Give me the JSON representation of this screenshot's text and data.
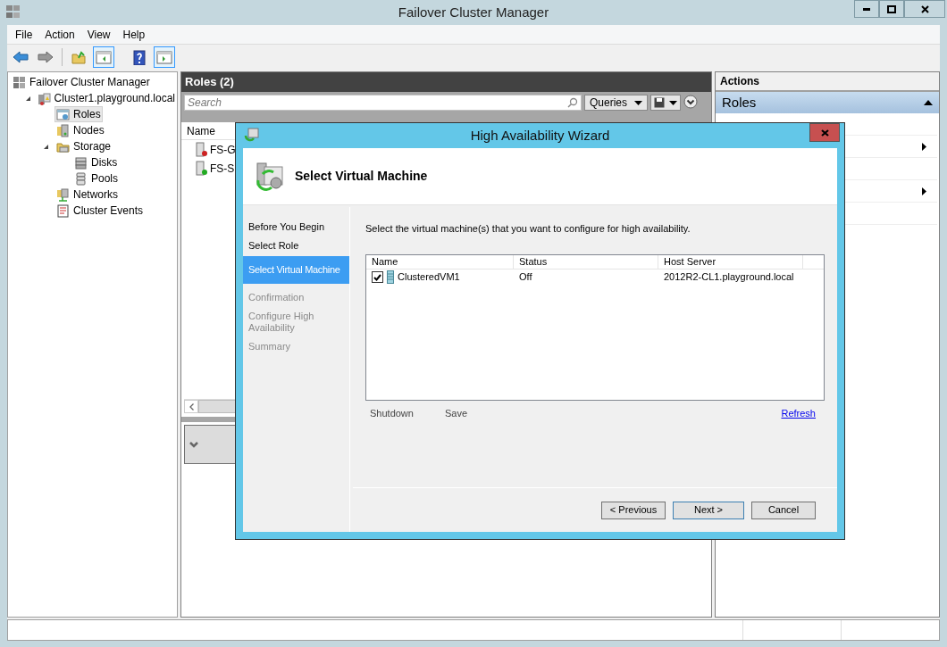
{
  "window": {
    "title": "Failover Cluster Manager"
  },
  "menu": [
    "File",
    "Action",
    "View",
    "Help"
  ],
  "toolbar": [
    {
      "kind": "back",
      "pressed": false
    },
    {
      "kind": "forward",
      "pressed": false
    },
    {
      "kind": "folder",
      "pressed": false
    },
    {
      "kind": "tree-pane",
      "pressed": true
    },
    {
      "kind": "help",
      "pressed": false
    },
    {
      "kind": "action-pane",
      "pressed": true
    }
  ],
  "tree": [
    {
      "label": "Failover Cluster Manager",
      "kind": "manager",
      "selected": false,
      "children": [
        {
          "label": "Cluster1.playground.local",
          "kind": "cluster",
          "selected": false,
          "expanded": true,
          "children": [
            {
              "label": "Roles",
              "kind": "roles",
              "selected": true
            },
            {
              "label": "Nodes",
              "kind": "nodes",
              "selected": false
            },
            {
              "label": "Storage",
              "kind": "storage",
              "selected": false,
              "expanded": true,
              "children": [
                {
                  "label": "Disks",
                  "kind": "disks",
                  "selected": false
                },
                {
                  "label": "Pools",
                  "kind": "pools",
                  "selected": false
                }
              ]
            },
            {
              "label": "Networks",
              "kind": "networks",
              "selected": false
            },
            {
              "label": "Cluster Events",
              "kind": "events",
              "selected": false
            }
          ]
        }
      ]
    }
  ],
  "roles_pane": {
    "title": "Roles (2)",
    "search": {
      "placeholder": "Search"
    },
    "queries_button": "Queries",
    "columns": [
      "Name"
    ],
    "rows": [
      {
        "name": "FS-G",
        "color": "#cc2222"
      },
      {
        "name": "FS-S",
        "color": "#22aa22"
      }
    ]
  },
  "actions_pane": {
    "title": "Actions",
    "section": "Roles",
    "rows": [
      {
        "submenu": false
      },
      {
        "submenu": true
      },
      {
        "submenu": false
      },
      {
        "submenu": true
      },
      {
        "submenu": false
      }
    ]
  },
  "wizard": {
    "title": "High Availability Wizard",
    "heading": "Select Virtual Machine",
    "steps": [
      {
        "label": "Before You Begin",
        "selected": false,
        "enabled": true
      },
      {
        "label": "Select Role",
        "selected": false,
        "enabled": true
      },
      {
        "label": "Select Virtual Machine",
        "selected": true,
        "enabled": true
      },
      {
        "label": "Confirmation",
        "selected": false,
        "enabled": false
      },
      {
        "label": "Configure High Availability",
        "selected": false,
        "enabled": false
      },
      {
        "label": "Summary",
        "selected": false,
        "enabled": false
      }
    ],
    "instruction": "Select the virtual machine(s) that you want to configure for high availability.",
    "columns": [
      "Name",
      "Status",
      "Host Server"
    ],
    "rows": [
      {
        "checked": true,
        "name": "ClusteredVM1",
        "status": "Off",
        "host": "2012R2-CL1.playground.local"
      }
    ],
    "actions": [
      "Shutdown",
      "Save"
    ],
    "refresh_link": "Refresh",
    "buttons": [
      {
        "label": "< Previous",
        "default": false
      },
      {
        "label": "Next >",
        "default": true
      },
      {
        "label": "Cancel",
        "default": false
      }
    ]
  }
}
